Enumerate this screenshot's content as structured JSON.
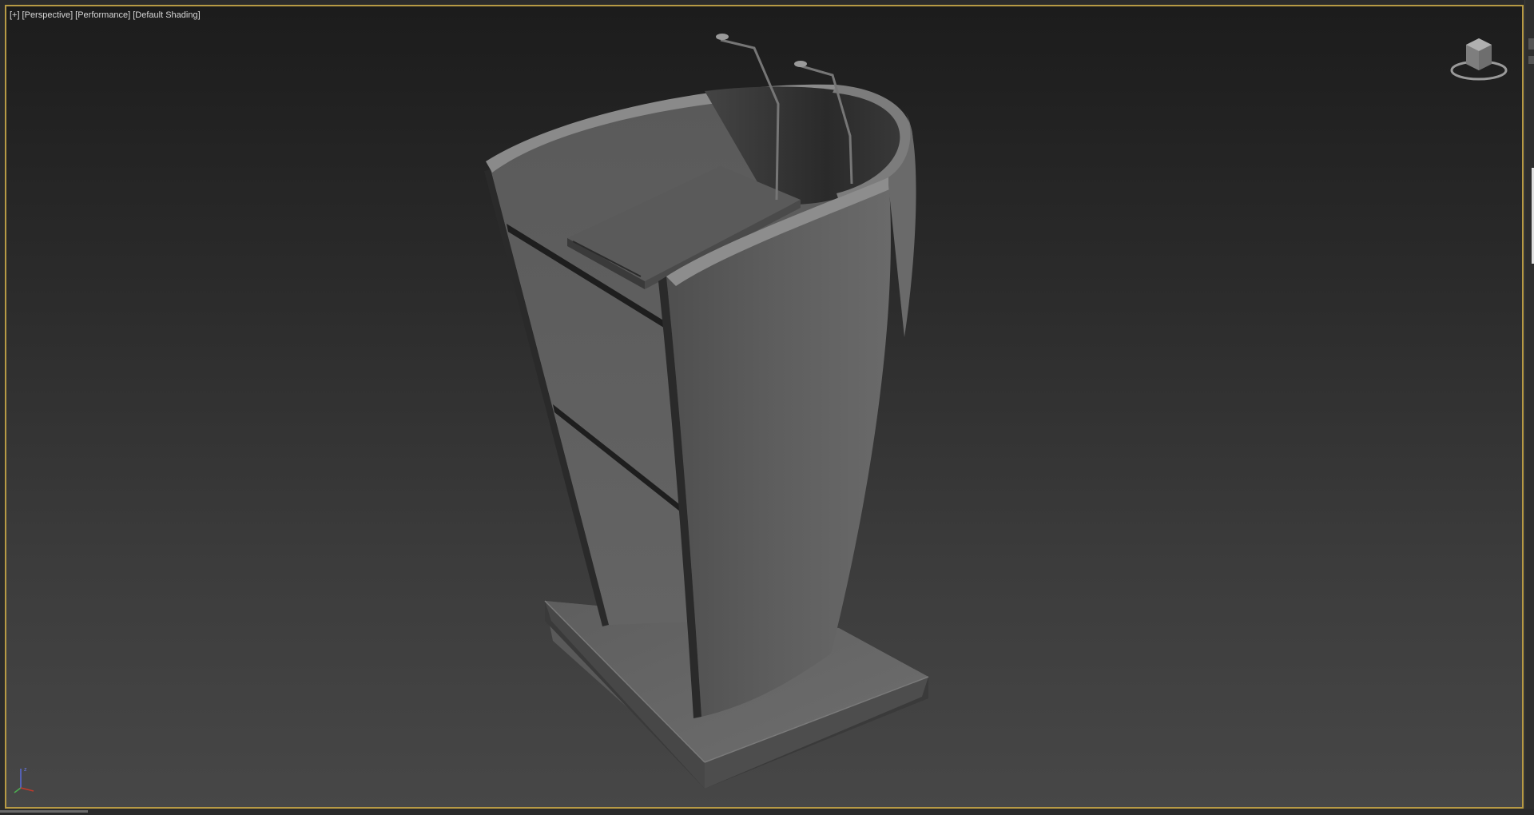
{
  "viewport": {
    "label_plus": "[+]",
    "label_view": "[Perspective]",
    "label_mode": "[Performance]",
    "label_shading": "[Default Shading]"
  },
  "icons": {
    "viewcube": "viewcube-icon",
    "axis": "axis-tripod-icon"
  },
  "colors": {
    "viewport_border": "#b79a45",
    "background_top": "#1c1c1c",
    "background_bottom": "#474747",
    "model_gray": "#5f5f5f"
  }
}
